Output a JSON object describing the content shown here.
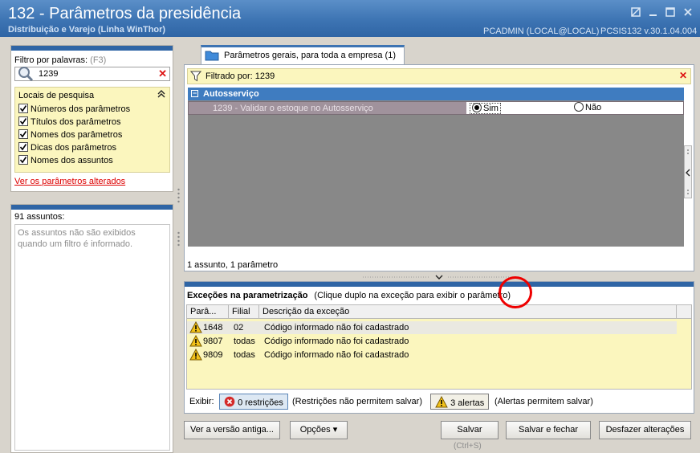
{
  "window": {
    "title": "132 - Parâmetros da presidência",
    "subtitle": "Distribuição e Varejo (Linha WinThor)",
    "user_info": "PCADMIN (LOCAL@LOCAL)",
    "version_info": "PCSIS132  v.30.1.04.004"
  },
  "filter": {
    "label": "Filtro por palavras:",
    "shortcut": "(F3)",
    "search_value": "1239",
    "locais_title": "Locais de pesquisa",
    "options": [
      {
        "label": "Números dos parâmetros",
        "checked": true
      },
      {
        "label": "Títulos dos parâmetros",
        "checked": true
      },
      {
        "label": "Nomes dos parâmetros",
        "checked": true
      },
      {
        "label": "Dicas dos parâmetros",
        "checked": true
      },
      {
        "label": "Nomes dos assuntos",
        "checked": true
      }
    ],
    "changed_link": "Ver os parâmetros alterados"
  },
  "subjects": {
    "count": "91 assuntos:",
    "message": "Os assuntos não são exibidos quando um filtro é informado."
  },
  "params": {
    "tab_label": "Parâmetros gerais, para toda a empresa  (1)",
    "filter_text": "Filtrado por: 1239",
    "group": "Autosserviço",
    "row": {
      "label": "1239 - Validar o estoque no Autosserviço",
      "option_yes": "Sim",
      "option_no": "Não",
      "selected": "Sim"
    },
    "summary": "1 assunto, 1 parâmetro"
  },
  "exceptions": {
    "title": "Exceções na parametrização",
    "hint": "(Clique duplo na exceção para exibir o parâmetro)",
    "columns": [
      "Parâ...",
      "Filial",
      "Descrição da exceção"
    ],
    "rows": [
      {
        "param": "1648",
        "filial": "02",
        "desc": "Código informado não foi cadastrado"
      },
      {
        "param": "9807",
        "filial": "todas",
        "desc": "Código informado não foi cadastrado"
      },
      {
        "param": "9809",
        "filial": "todas",
        "desc": "Código informado não foi cadastrado"
      }
    ],
    "exibir_label": "Exibir:",
    "restrictions_btn": "0 restrições",
    "restrictions_note": "(Restrições não permitem salvar)",
    "alerts_btn": "3 alertas",
    "alerts_note": "(Alertas permitem salvar)"
  },
  "buttons": {
    "old_version": "Ver a versão antiga...",
    "options": "Opções",
    "save": "Salvar",
    "save_shortcut": "(Ctrl+S)",
    "save_close": "Salvar e fechar",
    "undo": "Desfazer alterações"
  },
  "colors": {
    "titlebar": "#3d74b3",
    "group_header": "#3f7cc0",
    "filter_yellow": "#fbf6be",
    "highlight_circle": "#e00000"
  }
}
